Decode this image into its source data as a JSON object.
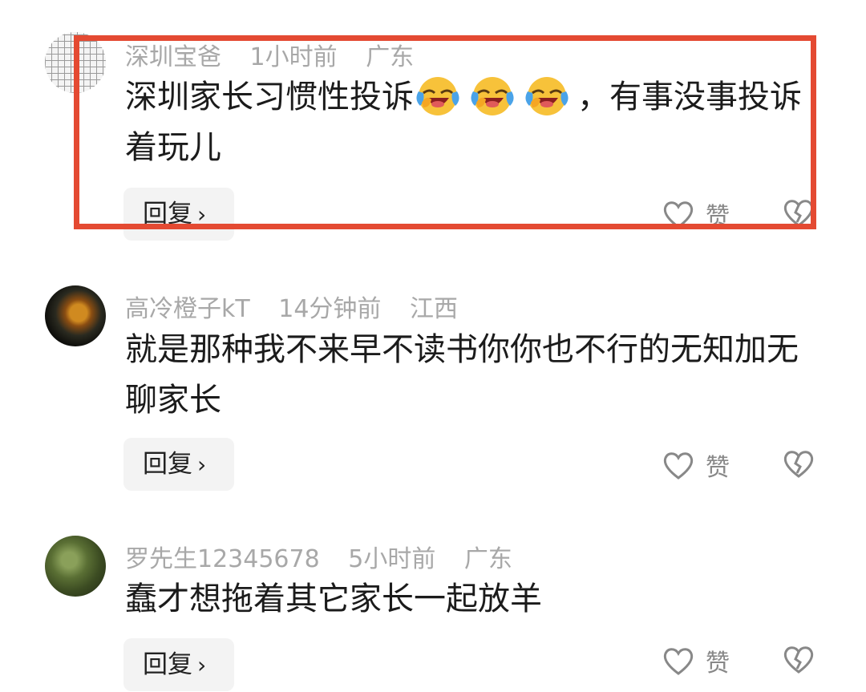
{
  "comments": [
    {
      "username": "深圳宝爸",
      "time": "1小时前",
      "location": "广东",
      "text_part1": "深圳家长习惯性投诉",
      "emoji": [
        "laughing-crying-emoji",
        "laughing-crying-emoji",
        "laughing-crying-emoji"
      ],
      "text_part2": "，有事没事投诉着玩儿",
      "reply_label": "回复",
      "like_label": "赞",
      "highlighted": true
    },
    {
      "username": "高冷橙子kT",
      "time": "14分钟前",
      "location": "江西",
      "text": "就是那种我不来早不读书你你也不行的无知加无聊家长",
      "reply_label": "回复",
      "like_label": "赞"
    },
    {
      "username": "罗先生12345678",
      "time": "5小时前",
      "location": "广东",
      "text": "蠢才想拖着其它家长一起放羊",
      "reply_label": "回复",
      "like_label": "赞"
    }
  ],
  "colors": {
    "highlight_border": "#e44a32",
    "meta_text": "#a8a8a8",
    "body_text": "#1b1b1b",
    "reply_bg": "#f3f3f3"
  },
  "icons": [
    "heart-icon",
    "broken-heart-icon",
    "chevron-right-icon"
  ]
}
